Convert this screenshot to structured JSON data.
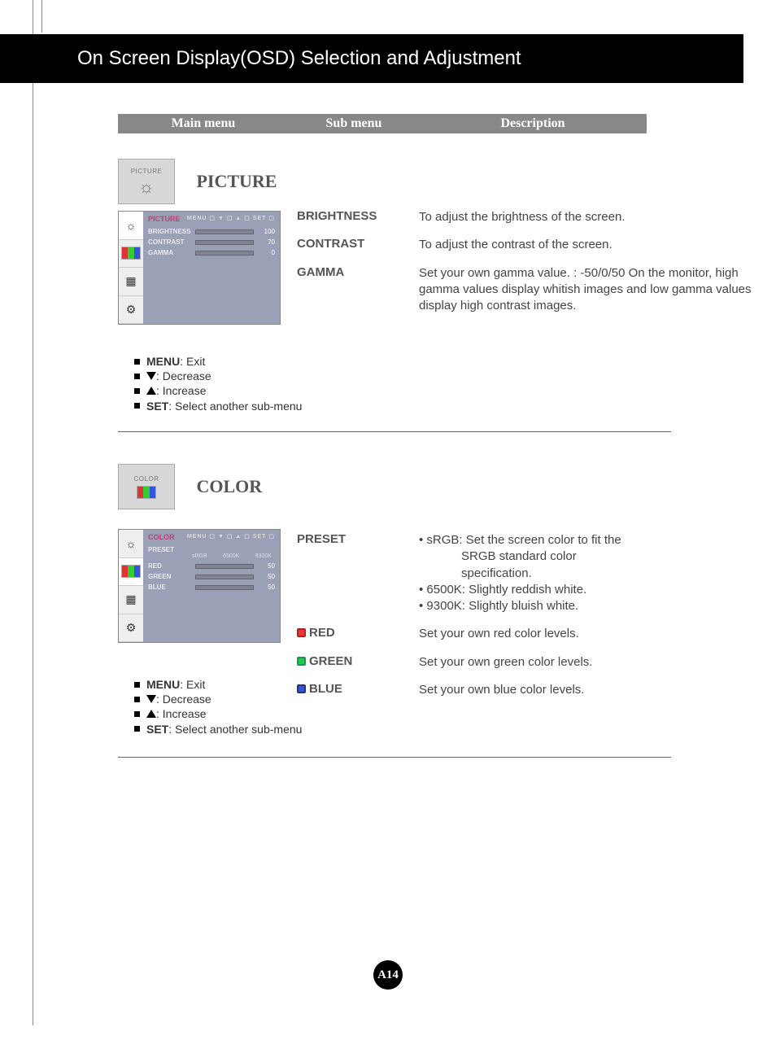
{
  "page_title": "On Screen Display(OSD) Selection and Adjustment",
  "columns": {
    "c1": "Main menu",
    "c2": "Sub menu",
    "c3": "Description"
  },
  "picture": {
    "icon_label": "PICTURE",
    "title": "PICTURE",
    "osd": {
      "header": "PICTURE",
      "nav": "MENU ▢  ▼ ▢  ▲ ▢  SET ▢",
      "rows": [
        {
          "name": "BRIGHTNESS",
          "value": "100",
          "fill": 100
        },
        {
          "name": "CONTRAST",
          "value": "70",
          "fill": 70
        },
        {
          "name": "GAMMA",
          "value": "0",
          "fill": 50
        }
      ]
    },
    "items": [
      {
        "sub": "BRIGHTNESS",
        "desc": "To adjust the brightness of the screen."
      },
      {
        "sub": "CONTRAST",
        "desc": "To adjust the contrast of the screen."
      },
      {
        "sub": "GAMMA",
        "desc": "Set your own gamma value. : -50/0/50 On the monitor, high gamma values display whitish images and low gamma values display high contrast images."
      }
    ],
    "legend": {
      "menu_label": "MENU",
      "menu_text": " : Exit",
      "dec_text": " : Decrease",
      "inc_text": " : Increase",
      "set_label": "SET",
      "set_text": " : Select another sub-menu"
    }
  },
  "color": {
    "icon_label": "COLOR",
    "title": "COLOR",
    "osd": {
      "header": "COLOR",
      "nav": "MENU ▢  ▼ ▢  ▲ ▢  SET ▢",
      "preset_label": "PRESET",
      "preset_opts": [
        "sRGB",
        "6500K",
        "9300K"
      ],
      "rows": [
        {
          "name": "RED",
          "value": "50",
          "fill": 50
        },
        {
          "name": "GREEN",
          "value": "50",
          "fill": 50
        },
        {
          "name": "BLUE",
          "value": "50",
          "fill": 50
        }
      ]
    },
    "preset": {
      "sub": "PRESET",
      "l1a": "sRGB: Set the screen color to fit the",
      "l1b": "SRGB standard color",
      "l1c": "specification.",
      "l2": "6500K: Slightly reddish white.",
      "l3": "9300K: Slightly bluish white."
    },
    "red": {
      "sub": "RED",
      "desc": "Set your own red color levels."
    },
    "green": {
      "sub": "GREEN",
      "desc": "Set your own green color levels."
    },
    "blue": {
      "sub": "BLUE",
      "desc": "Set your own blue color levels."
    },
    "legend": {
      "menu_label": "MENU",
      "menu_text": " : Exit",
      "dec_text": " : Decrease",
      "inc_text": " : Increase",
      "set_label": "SET",
      "set_text": " : Select another sub-menu"
    }
  },
  "page_number": "A14"
}
